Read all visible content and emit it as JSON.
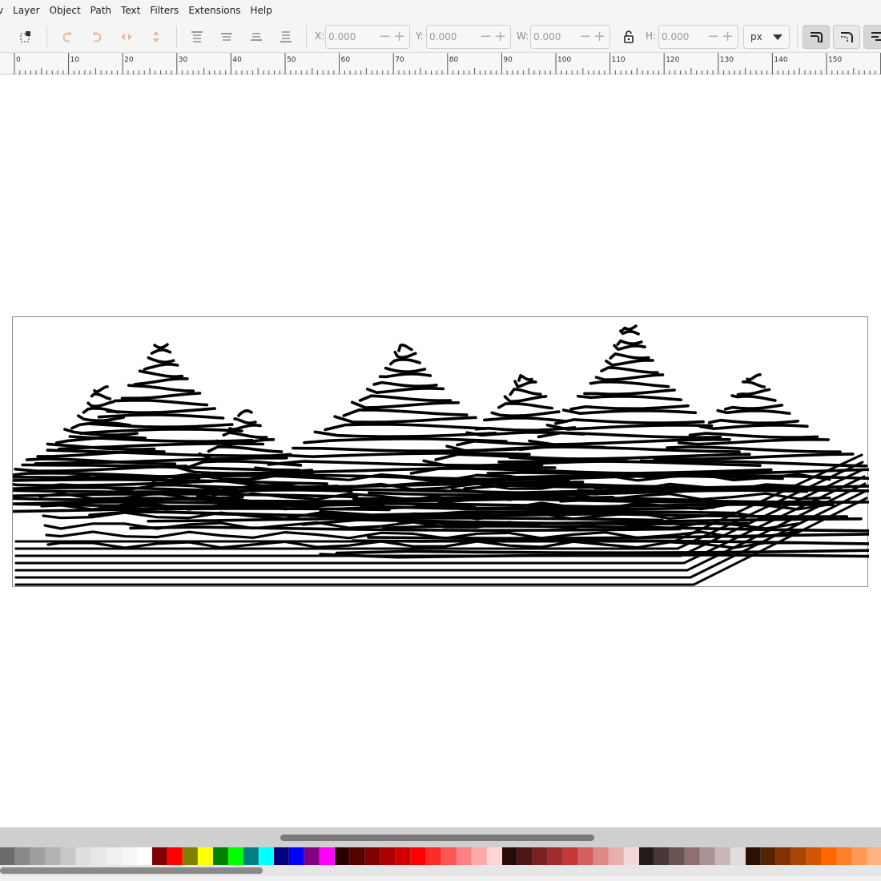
{
  "menubar": {
    "items": [
      {
        "label": "v"
      },
      {
        "label": "Layer"
      },
      {
        "label": "Object"
      },
      {
        "label": "Path"
      },
      {
        "label": "Text"
      },
      {
        "label": "Filters"
      },
      {
        "label": "Extensions"
      },
      {
        "label": "Help"
      }
    ]
  },
  "toolbar": {
    "x_label": "X:",
    "x_value": "0.000",
    "y_label": "Y:",
    "y_value": "0.000",
    "w_label": "W:",
    "w_value": "0.000",
    "h_label": "H:",
    "h_value": "0.000",
    "unit": "px",
    "icons": [
      "select-all-icon",
      "rotate-ccw-icon",
      "rotate-cw-icon",
      "flip-horizontal-icon",
      "flip-vertical-icon",
      "raise-to-top-icon",
      "raise-icon",
      "lower-icon",
      "lower-to-bottom-icon",
      "lock-ratio-icon",
      "scale-stroke-icon",
      "scale-corners-icon",
      "move-gradients-icon"
    ]
  },
  "ruler": {
    "labels": [
      "0",
      "10",
      "20",
      "30",
      "40",
      "50",
      "60",
      "70",
      "80",
      "90",
      "100",
      "110",
      "120",
      "130",
      "140",
      "150"
    ]
  },
  "palette": {
    "colors": [
      "#6b6b6b",
      "#888888",
      "#9e9e9e",
      "#b3b3b3",
      "#c8c8c8",
      "#dedede",
      "#e8e8e8",
      "#f0f0f0",
      "#f7f7f7",
      "#ffffff",
      "#800000",
      "#ff0000",
      "#808000",
      "#ffff00",
      "#008000",
      "#00ff00",
      "#008080",
      "#00ffff",
      "#000080",
      "#0000ff",
      "#800080",
      "#ff00ff",
      "#2b0000",
      "#550000",
      "#800000",
      "#aa0000",
      "#d40000",
      "#ff0000",
      "#ff2a2a",
      "#ff5555",
      "#ff8080",
      "#ffaaaa",
      "#ffd5d5",
      "#280b0b",
      "#501616",
      "#782121",
      "#a02c2c",
      "#c83737",
      "#d35f5f",
      "#de8787",
      "#e9afaf",
      "#f4d7d7",
      "#241c1c",
      "#483737",
      "#6c5353",
      "#916f6f",
      "#ac9393",
      "#c8b7b7",
      "#e3dbdb",
      "#2b1100",
      "#552200",
      "#803300",
      "#aa4400",
      "#d45500",
      "#ff6600",
      "#ff7f2a",
      "#ff9955",
      "#ffb380"
    ]
  }
}
